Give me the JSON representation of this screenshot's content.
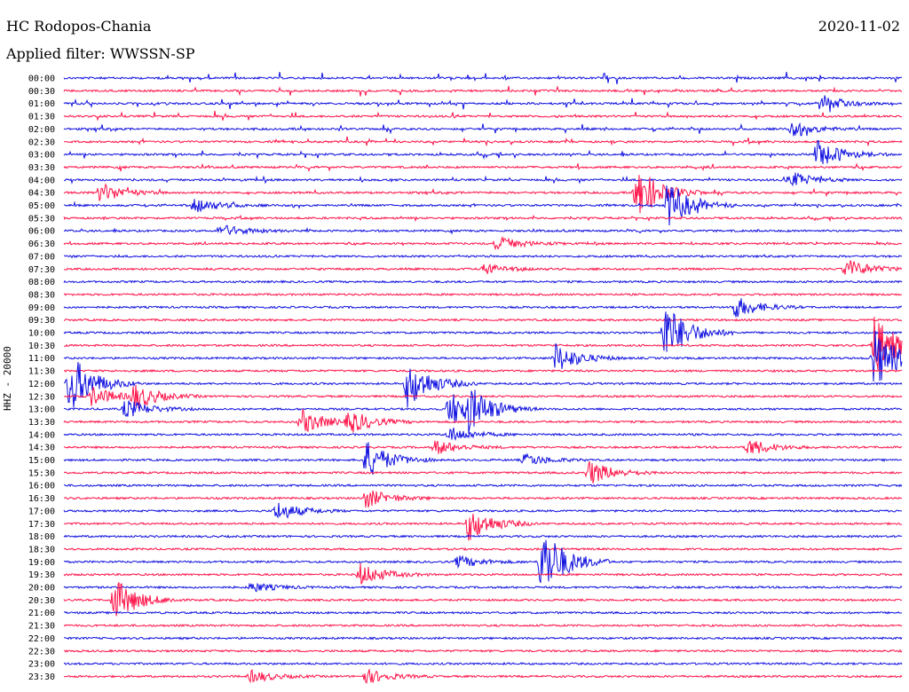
{
  "header": {
    "station": "HC Rodopos-Chania",
    "date": "2020-11-02",
    "filter": "Applied filter: WWSSN-SP",
    "channel": "HHZ - 20000"
  },
  "colors": {
    "trace_a": "#1010e0",
    "trace_b": "#ff1248"
  },
  "chart_data": {
    "type": "line",
    "style": "helicorder",
    "title": "HC Rodopos-Chania",
    "subtitle": "Applied filter: WWSSN-SP",
    "ylabel": "HHZ - 20000",
    "date": "2020-11-02",
    "minutes_per_line": 30,
    "series_colors": [
      "#1010e0",
      "#ff1248"
    ],
    "time_labels": [
      "00:00",
      "00:30",
      "01:00",
      "01:30",
      "02:00",
      "02:30",
      "03:00",
      "03:30",
      "04:00",
      "04:30",
      "05:00",
      "05:30",
      "06:00",
      "06:30",
      "07:00",
      "07:30",
      "08:00",
      "08:30",
      "09:00",
      "09:30",
      "10:00",
      "10:30",
      "11:00",
      "11:30",
      "12:00",
      "12:30",
      "13:00",
      "13:30",
      "14:00",
      "14:30",
      "15:00",
      "15:30",
      "16:00",
      "16:30",
      "17:00",
      "17:30",
      "18:00",
      "18:30",
      "19:00",
      "19:30",
      "20:00",
      "20:30",
      "21:00",
      "21:30",
      "22:00",
      "22:30",
      "23:00",
      "23:30"
    ],
    "events": [
      {
        "line": 2,
        "minute": 27,
        "amp": 0.8
      },
      {
        "line": 4,
        "minute": 26,
        "amp": 0.6
      },
      {
        "line": 6,
        "minute": 27,
        "amp": 1.2
      },
      {
        "line": 8,
        "minute": 26,
        "amp": 0.7
      },
      {
        "line": 9,
        "minute": 1.3,
        "amp": 0.8
      },
      {
        "line": 9,
        "minute": 20.5,
        "amp": 2.2
      },
      {
        "line": 10,
        "minute": 4.7,
        "amp": 0.6
      },
      {
        "line": 10,
        "minute": 21.6,
        "amp": 1.8
      },
      {
        "line": 12,
        "minute": 5.6,
        "amp": 0.5
      },
      {
        "line": 13,
        "minute": 15.5,
        "amp": 0.6
      },
      {
        "line": 15,
        "minute": 15,
        "amp": 0.4
      },
      {
        "line": 15,
        "minute": 28,
        "amp": 0.8
      },
      {
        "line": 18,
        "minute": 24,
        "amp": 0.9
      },
      {
        "line": 20,
        "minute": 21.5,
        "amp": 2.5
      },
      {
        "line": 21,
        "minute": 29,
        "amp": 2.5
      },
      {
        "line": 22,
        "minute": 17.6,
        "amp": 1.2
      },
      {
        "line": 22,
        "minute": 29,
        "amp": 2.5
      },
      {
        "line": 24,
        "minute": 0.2,
        "amp": 2.5
      },
      {
        "line": 24,
        "minute": 12.3,
        "amp": 2.0
      },
      {
        "line": 25,
        "minute": 1.0,
        "amp": 0.8
      },
      {
        "line": 25,
        "minute": 2.5,
        "amp": 1.0
      },
      {
        "line": 26,
        "minute": 13.8,
        "amp": 1.5
      },
      {
        "line": 26,
        "minute": 14.5,
        "amp": 1.4
      },
      {
        "line": 26,
        "minute": 2.2,
        "amp": 0.8
      },
      {
        "line": 27,
        "minute": 8.5,
        "amp": 1.0
      },
      {
        "line": 27,
        "minute": 10.2,
        "amp": 0.9
      },
      {
        "line": 28,
        "minute": 13.8,
        "amp": 0.6
      },
      {
        "line": 29,
        "minute": 13.3,
        "amp": 0.6
      },
      {
        "line": 29,
        "minute": 24.5,
        "amp": 0.7
      },
      {
        "line": 30,
        "minute": 10.8,
        "amp": 1.6
      },
      {
        "line": 30,
        "minute": 16.5,
        "amp": 0.5
      },
      {
        "line": 31,
        "minute": 18.8,
        "amp": 1.0
      },
      {
        "line": 33,
        "minute": 10.8,
        "amp": 0.8
      },
      {
        "line": 34,
        "minute": 7.6,
        "amp": 0.8
      },
      {
        "line": 35,
        "minute": 14.5,
        "amp": 1.4
      },
      {
        "line": 38,
        "minute": 17.1,
        "amp": 3.0
      },
      {
        "line": 38,
        "minute": 14.1,
        "amp": 0.5
      },
      {
        "line": 39,
        "minute": 10.6,
        "amp": 0.9
      },
      {
        "line": 40,
        "minute": 6.7,
        "amp": 0.4
      },
      {
        "line": 41,
        "minute": 1.8,
        "amp": 1.8
      },
      {
        "line": 47,
        "minute": 6.7,
        "amp": 0.5
      },
      {
        "line": 47,
        "minute": 10.8,
        "amp": 0.6
      }
    ]
  }
}
